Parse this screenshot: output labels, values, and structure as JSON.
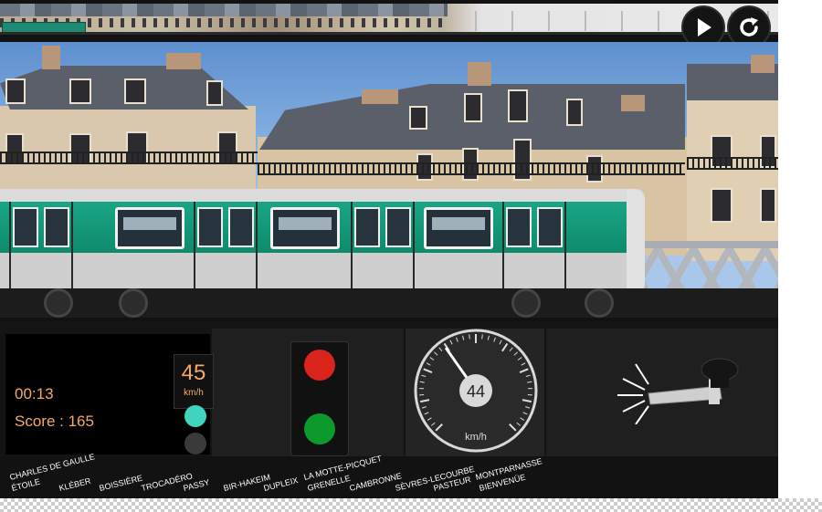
{
  "controls": {
    "play_icon": "play-icon",
    "restart_icon": "restart-icon"
  },
  "hud": {
    "timer": "00:13",
    "score": "Score : 165",
    "speed_display": "45",
    "speed_unit": "km/h",
    "door_lamp_color": "#3fd3c0",
    "off_lamp_color": "#3a3a3a"
  },
  "signal": {
    "red_color": "#d9241c",
    "green_color": "#0d9a2c"
  },
  "speedometer": {
    "value": "44",
    "unit": "km/h",
    "needle_fraction": 0.37
  },
  "stations": [
    "CHARLES DE GAULLE",
    "ÉTOILE",
    "KLÉBER",
    "BOISSIÈRE",
    "TROCADÉRO",
    "PASSY",
    "BIR-HAKEIM",
    "DUPLEIX",
    "LA MOTTE-PICQUET",
    "GRENELLE",
    "CAMBRONNE",
    "SÈVRES-LECOURBE",
    "PASTEUR",
    "MONTPARNASSE",
    "BIENVENÜE"
  ],
  "colors": {
    "train_green": "#15a07f",
    "hud_orange": "#f4a869"
  }
}
